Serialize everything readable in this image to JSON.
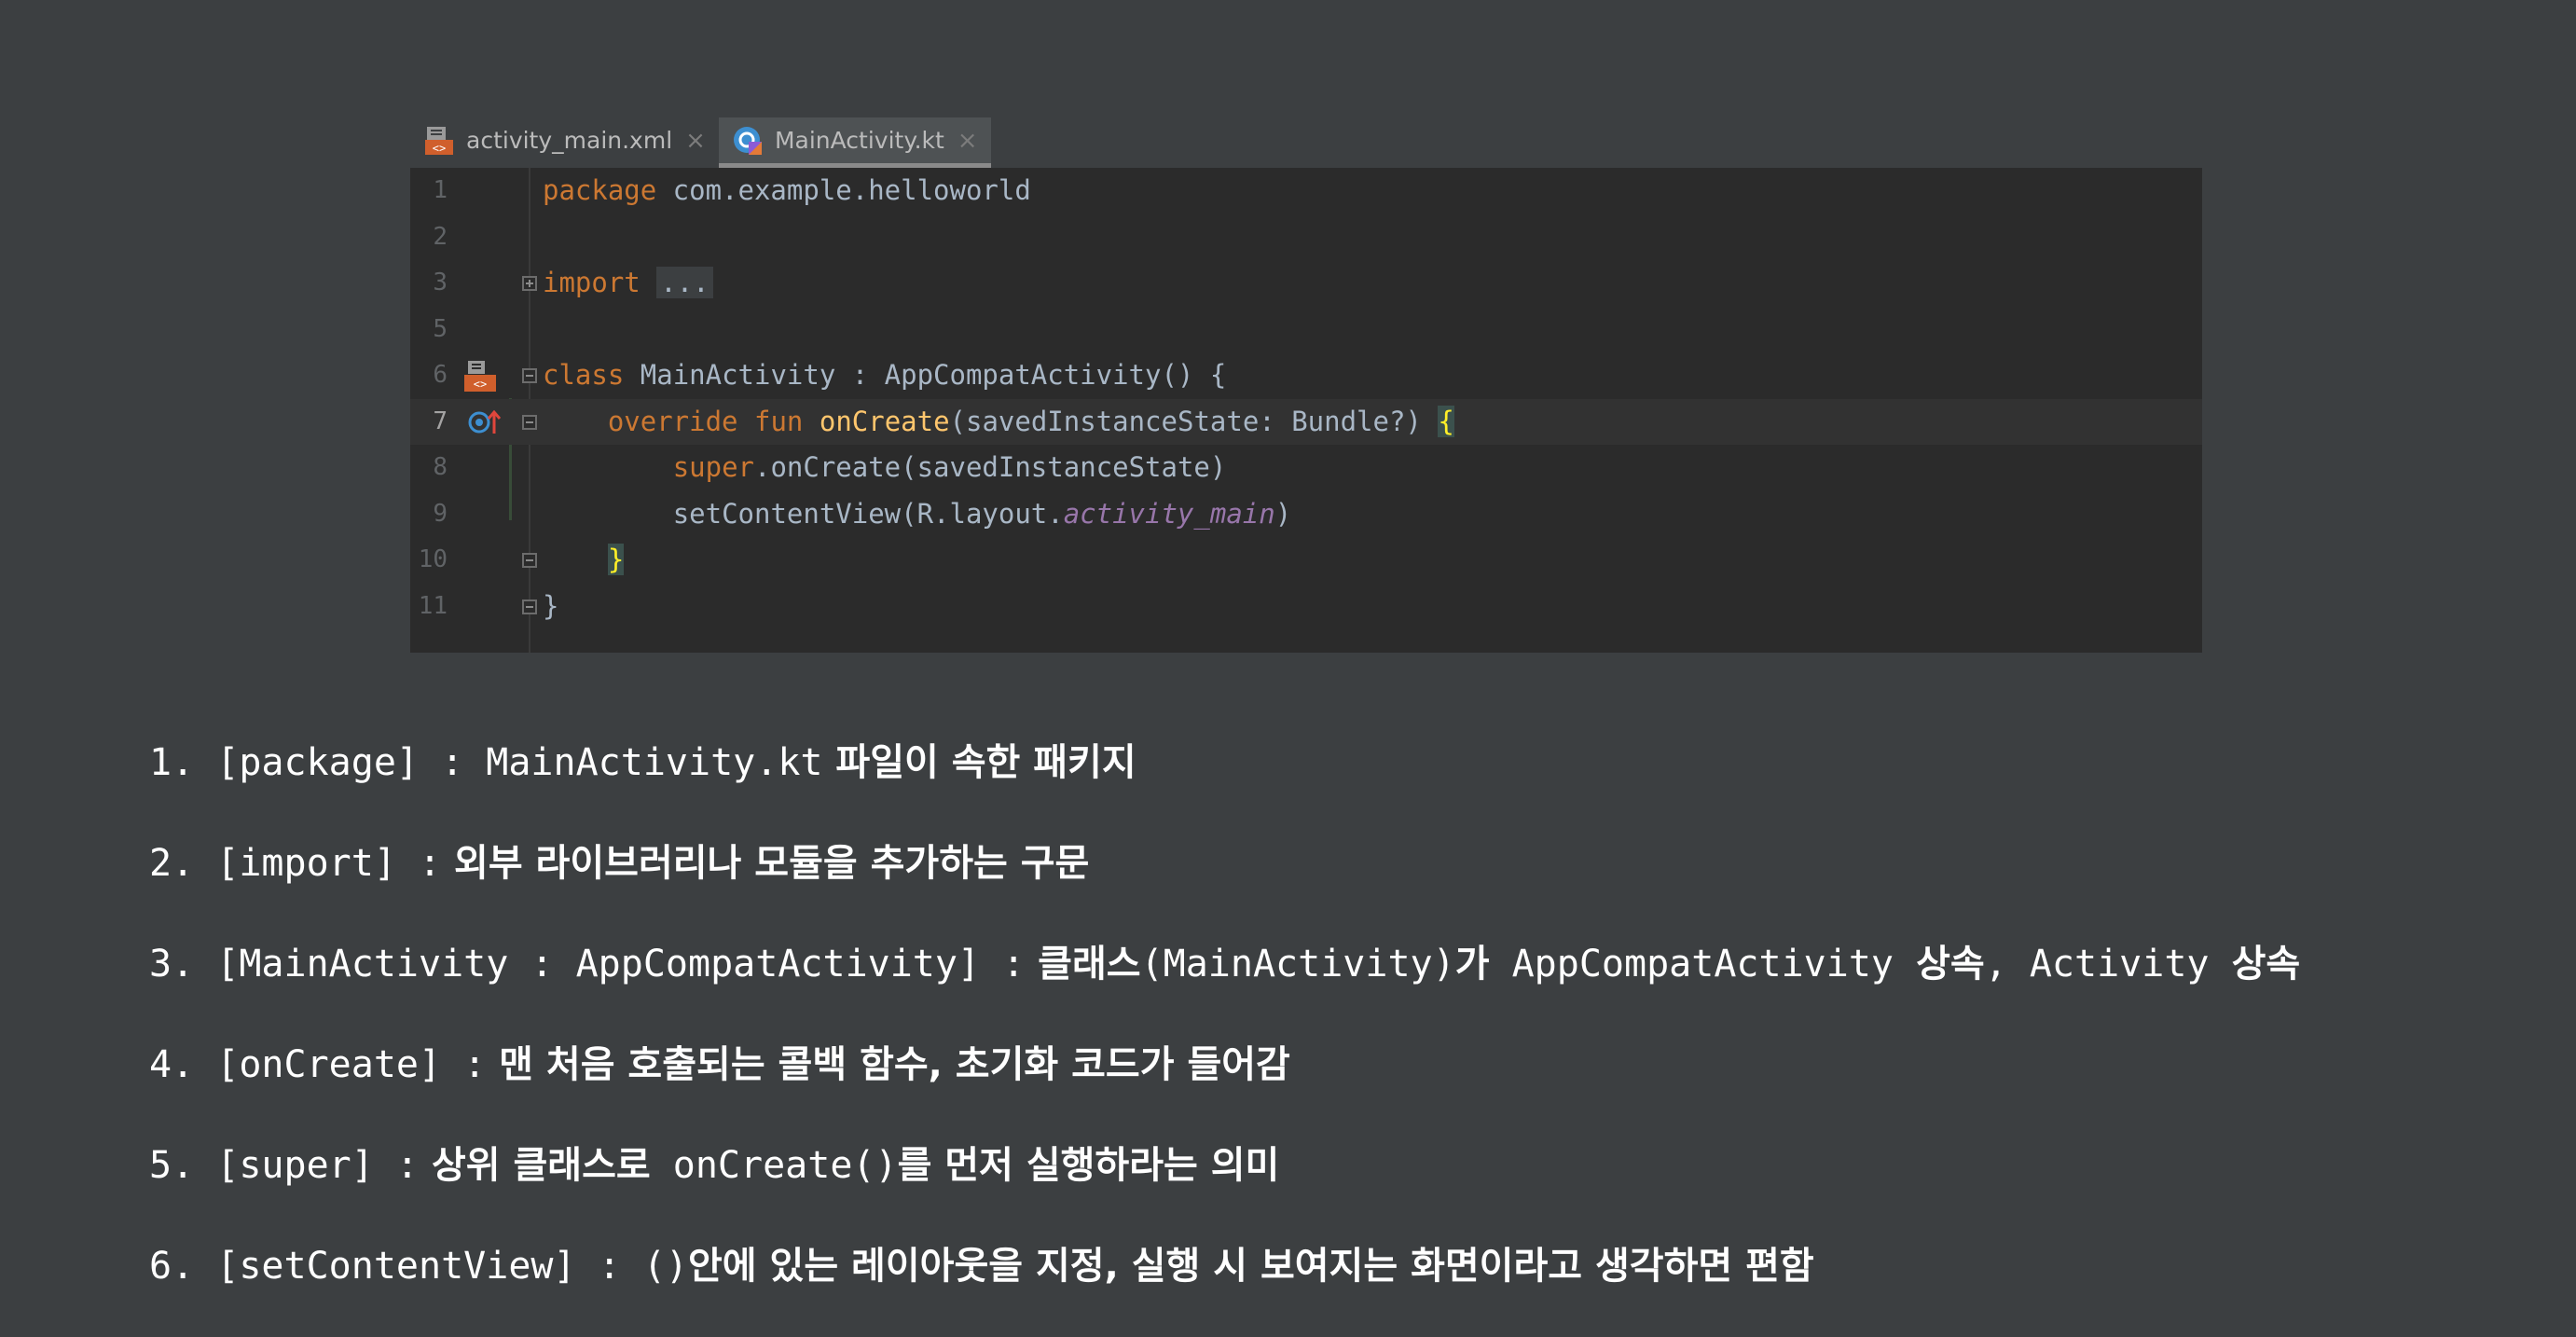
{
  "tabs": [
    {
      "label": "activity_main.xml",
      "icon": "xml-layout-icon",
      "active": false
    },
    {
      "label": "MainActivity.kt",
      "icon": "kotlin-class-icon",
      "active": true
    }
  ],
  "close_glyph": "×",
  "editor": {
    "line_numbers": [
      "1",
      "2",
      "3",
      "5",
      "6",
      "7",
      "8",
      "9",
      "10",
      "11"
    ],
    "current_line": "7",
    "code": {
      "l1_kw": "package",
      "l1_rest": " com.example.helloworld",
      "l3_kw": "import",
      "l3_placeholder": "...",
      "l6_kw": "class",
      "l6_rest": " MainActivity : AppCompatActivity() {",
      "l7_indent": "    ",
      "l7_kw1": "override",
      "l7_kw2": "fun",
      "l7_fn": "onCreate",
      "l7_params": "(savedInstanceState: Bundle?) ",
      "l7_brace": "{",
      "l8_indent": "        ",
      "l8_kw": "super",
      "l8_rest": ".onCreate(savedInstanceState)",
      "l9_indent": "        ",
      "l9_pre": "setContentView(R.layout.",
      "l9_prop": "activity_main",
      "l9_post": ")",
      "l10_indent": "    ",
      "l10_brace": "}",
      "l11_brace": "}"
    },
    "colors": {
      "background": "#2b2b2b",
      "keyword": "#cc7832",
      "function": "#ffc66d",
      "property": "#9876aa",
      "text": "#a9b7c6",
      "line_number": "#606366"
    }
  },
  "notes": [
    {
      "num": "1.",
      "code": "[package] : MainActivity.kt",
      "desc": " 파일이 속한 패키지"
    },
    {
      "num": "2.",
      "code": "[import] :",
      "desc": " 외부 라이브러리나 모듈을 추가하는 구문"
    },
    {
      "num": "3.",
      "code": "[MainActivity : AppCompatActivity] :",
      "desc": " 클래스",
      "code2": "(MainActivity)",
      "desc2": "가",
      "code3": " AppCompatActivity ",
      "desc3": "상속",
      "code4": ", Activity ",
      "desc4": "상속"
    },
    {
      "num": "4.",
      "code": "[onCreate] :",
      "desc": " 맨 처음 호출되는 콜백 함수, 초기화 코드가 들어감"
    },
    {
      "num": "5.",
      "code": "[super] :",
      "desc": " 상위 클래스로",
      "code2": " onCreate()",
      "desc2": "를 먼저 실행하라는 의미"
    },
    {
      "num": "6.",
      "code": "[setContentView] : ()",
      "desc": "안에 있는 레이아웃을 지정, 실행 시 보여지는 화면이라고 생각하면 편함"
    }
  ]
}
